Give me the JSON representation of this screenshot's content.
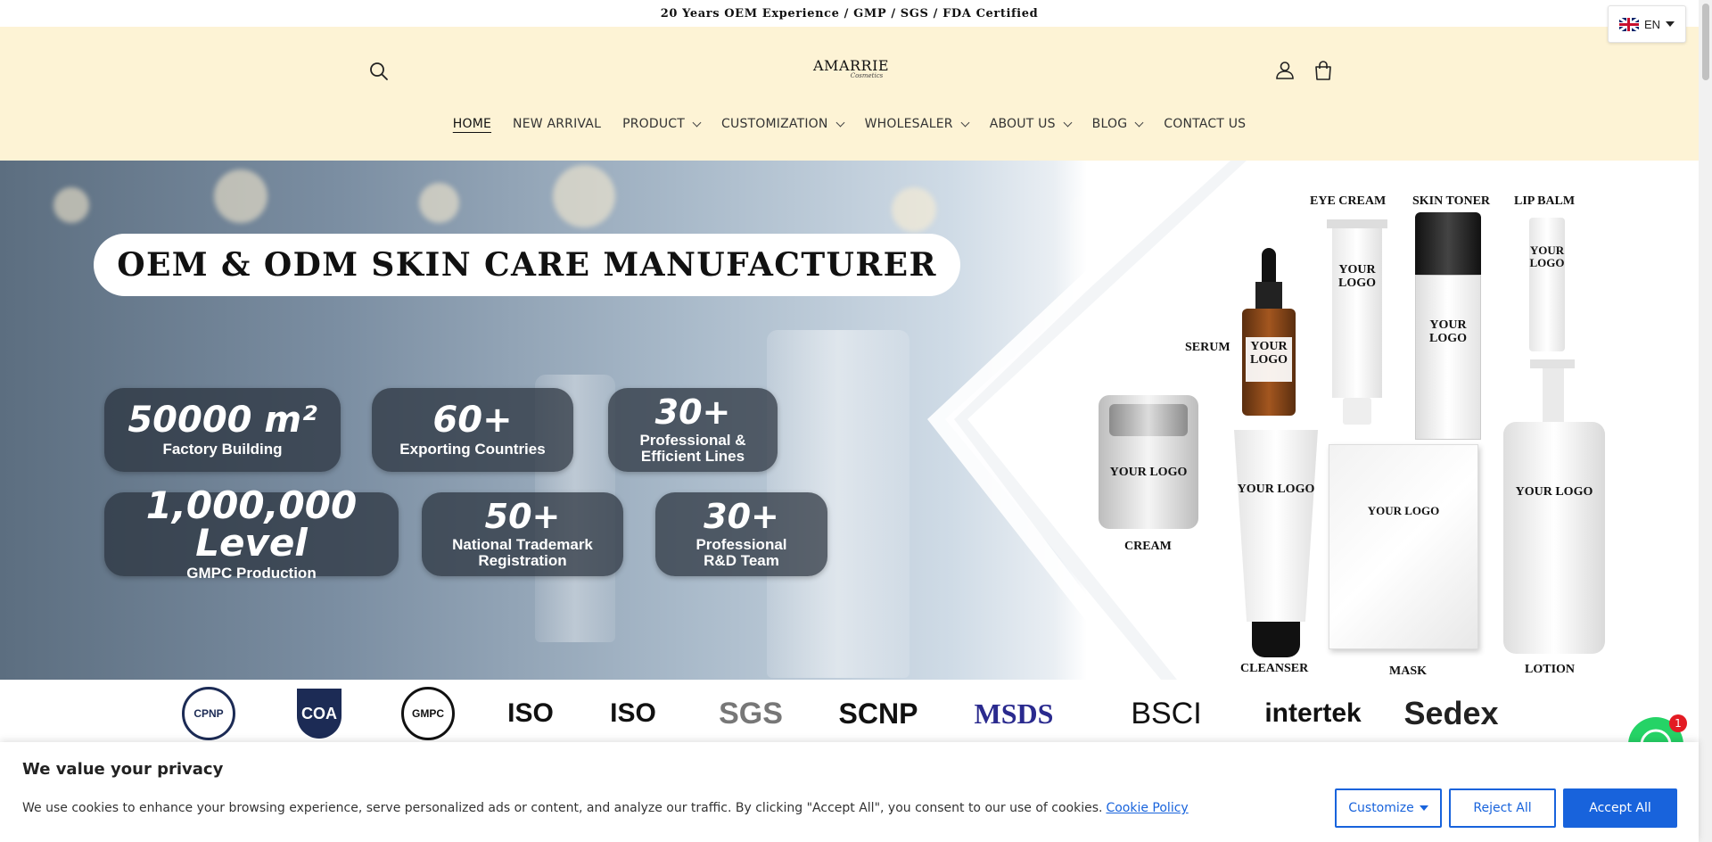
{
  "announcement": "20 Years OEM Experience / GMP / SGS / FDA Certified",
  "language": {
    "code": "EN"
  },
  "header": {
    "logo": {
      "brand": "AMARRIE",
      "sub": "Cosmetics"
    },
    "nav": [
      {
        "label": "HOME",
        "active": true,
        "dropdown": false
      },
      {
        "label": "NEW ARRIVAL",
        "dropdown": false
      },
      {
        "label": "PRODUCT",
        "dropdown": true
      },
      {
        "label": "CUSTOMIZATION",
        "dropdown": true
      },
      {
        "label": "WHOLESALER",
        "dropdown": true
      },
      {
        "label": "ABOUT US",
        "dropdown": true
      },
      {
        "label": "BLOG",
        "dropdown": true
      },
      {
        "label": "CONTACT US",
        "dropdown": false
      }
    ]
  },
  "hero": {
    "headline": "OEM & ODM SKIN CARE MANUFACTURER",
    "stats": [
      {
        "value": "50000 m²",
        "label": "Factory Building"
      },
      {
        "value": "60+",
        "label": "Exporting Countries"
      },
      {
        "value": "30+",
        "label": "Professional & Efficient Lines"
      },
      {
        "value": "1,000,000 Level",
        "label": "GMPC Production"
      },
      {
        "value": "50+",
        "label": "National Trademark Registration"
      },
      {
        "value": "30+",
        "label": "Professional R&D Team"
      }
    ],
    "your_logo": "YOUR LOGO",
    "products": {
      "eye_cream": "EYE CREAM",
      "skin_toner": "SKIN TONER",
      "lip_balm": "LIP BALM",
      "serum": "SERUM",
      "cream": "CREAM",
      "cleanser": "CLEANSER",
      "mask": "MASK",
      "lotion": "LOTION"
    }
  },
  "certifications": [
    "CPNP",
    "COA",
    "GMPC",
    "ISO",
    "ISO",
    "SGS",
    "SCNP",
    "MSDS",
    "BSCI",
    "intertek",
    "Sedex"
  ],
  "cookie": {
    "title": "We value your privacy",
    "text": "We use cookies to enhance your browsing experience, serve personalized ads or content, and analyze our traffic. By clicking \"Accept All\", you consent to our use of cookies.",
    "link": "Cookie Policy",
    "customize": "Customize",
    "reject": "Reject All",
    "accept": "Accept All"
  },
  "chat": {
    "badge": "1"
  },
  "colors": {
    "header_bg": "#fdf3d5",
    "accent": "#1863dc",
    "chat": "#25d366"
  }
}
